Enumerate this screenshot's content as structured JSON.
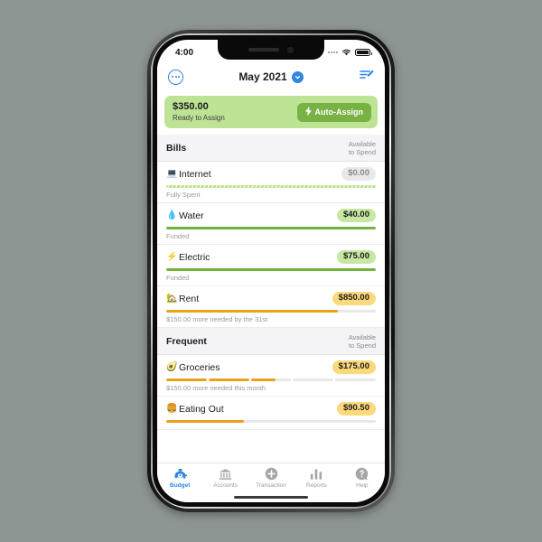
{
  "status_bar": {
    "time": "4:00",
    "signal_icon": "signal-dots-icon",
    "wifi_icon": "wifi-icon",
    "battery_icon": "battery-icon"
  },
  "header": {
    "menu_icon": "more-circle-icon",
    "title": "May 2021",
    "chevron_icon": "chevron-down-icon",
    "edit_icon": "edit-list-icon"
  },
  "ready_to_assign": {
    "amount": "$350.00",
    "label": "Ready to Assign",
    "button_label": "Auto-Assign",
    "button_icon": "lightning-bolt-icon",
    "banner_color": "#bde394",
    "button_color": "#78b244"
  },
  "available_header": {
    "line1": "Available",
    "line2": "to Spend"
  },
  "groups": [
    {
      "name": "Bills",
      "categories": [
        {
          "emoji": "💻",
          "icon_name": "laptop-icon",
          "name": "Internet",
          "amount": "$0.00",
          "pill_style": "gray",
          "bar_style": "striped",
          "progress": 100,
          "note": "Fully Spent"
        },
        {
          "emoji": "💧",
          "icon_name": "water-drop-icon",
          "name": "Water",
          "amount": "$40.00",
          "pill_style": "green",
          "bar_style": "solid-green",
          "progress": 100,
          "note": "Funded"
        },
        {
          "emoji": "⚡",
          "icon_name": "lightning-icon",
          "name": "Electric",
          "amount": "$75.00",
          "pill_style": "green",
          "bar_style": "solid-green",
          "progress": 100,
          "note": "Funded"
        },
        {
          "emoji": "🏡",
          "icon_name": "house-icon",
          "name": "Rent",
          "amount": "$850.00",
          "pill_style": "amber",
          "bar_style": "solid-amber",
          "progress": 82,
          "note": "$150.00 more needed by the 31st"
        }
      ]
    },
    {
      "name": "Frequent",
      "categories": [
        {
          "emoji": "🥑",
          "icon_name": "avocado-icon",
          "name": "Groceries",
          "amount": "$175.00",
          "pill_style": "amber",
          "bar_style": "segmented",
          "segments": [
            100,
            100,
            62,
            0,
            0
          ],
          "note": "$150.00 more needed this month"
        },
        {
          "emoji": "🍔",
          "icon_name": "burger-icon",
          "name": "Eating Out",
          "amount": "$90.50",
          "pill_style": "amber",
          "bar_style": "solid-amber",
          "progress": 37,
          "note": ""
        }
      ]
    }
  ],
  "tabs": [
    {
      "label": "Budget",
      "icon": "piggy-bank-icon",
      "active": true
    },
    {
      "label": "Accounts",
      "icon": "bank-icon",
      "active": false
    },
    {
      "label": "Transaction",
      "icon": "plus-circle-icon",
      "active": false
    },
    {
      "label": "Reports",
      "icon": "bar-chart-icon",
      "active": false
    },
    {
      "label": "Help",
      "icon": "question-icon",
      "active": false
    }
  ],
  "colors": {
    "accent_blue": "#2f86e0",
    "green": "#6fb33c",
    "amber": "#e9a21a"
  }
}
